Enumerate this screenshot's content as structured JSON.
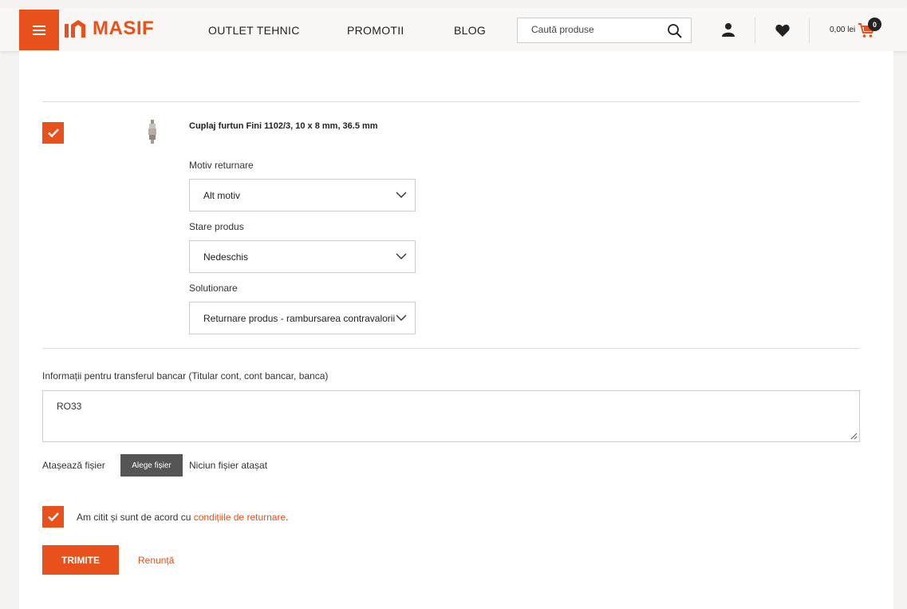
{
  "header": {
    "logo_text": "MASIF",
    "nav": [
      "OUTLET TEHNIC",
      "PROMOTII",
      "BLOG"
    ],
    "search_placeholder": "Caută produse",
    "cart_total": "0,00 lei",
    "cart_count": "0",
    "brand_color": "#e8511b",
    "icons": [
      "menu-icon",
      "search-icon",
      "user-icon",
      "heart-icon",
      "cart-icon"
    ]
  },
  "product": {
    "name": "Cuplaj furtun Fini 1102/3, 10 x 8 mm, 36.5 mm",
    "checked": true
  },
  "fields": {
    "motiv_label": "Motiv returnare",
    "motiv_value": "Alt motiv",
    "stare_label": "Stare produs",
    "stare_value": "Nedeschis",
    "solutionare_label": "Solutionare",
    "solutionare_value": "Returnare produs - rambursarea contravalorii"
  },
  "bank": {
    "label": "Informații pentru transferul bancar (Titular cont, cont bancar, banca)",
    "value": "RO33"
  },
  "attach": {
    "label": "Atașează fișier",
    "button": "Alege fișier",
    "status": "Niciun fișier atașat"
  },
  "agree": {
    "text": "Am citit și sunt de acord cu ",
    "link": "condițiile de returnare",
    "suffix": "."
  },
  "actions": {
    "submit": "TRIMITE",
    "cancel": "Renunță"
  }
}
